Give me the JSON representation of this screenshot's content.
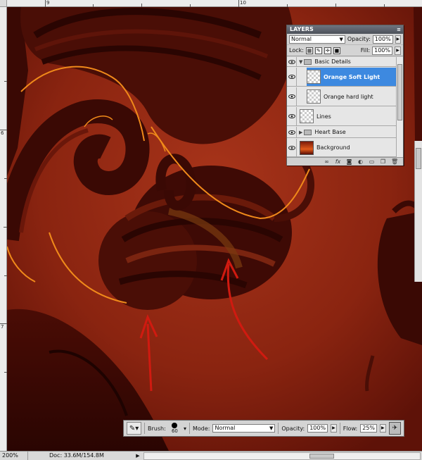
{
  "rulers": {
    "top_labels": [
      "9",
      "10"
    ],
    "left_labels": [
      "6",
      "7"
    ]
  },
  "status": {
    "zoom": "200%",
    "doc": "Doc: 33.6M/154.8M"
  },
  "layers_panel": {
    "title": "LAYERS",
    "blend_mode": "Normal",
    "opacity_label": "Opacity:",
    "opacity_value": "100%",
    "lock_label": "Lock:",
    "fill_label": "Fill:",
    "fill_value": "100%",
    "layers": [
      {
        "name": "Basic Details",
        "kind": "group-open",
        "selected": false
      },
      {
        "name": "Orange Soft Light",
        "kind": "layer-indented",
        "selected": true
      },
      {
        "name": "Orange hard light",
        "kind": "layer-indented",
        "selected": false
      },
      {
        "name": "Lines",
        "kind": "layer",
        "selected": false
      },
      {
        "name": "Heart Base",
        "kind": "group-closed",
        "selected": false
      },
      {
        "name": "Background",
        "kind": "background",
        "selected": false
      }
    ],
    "footer_icons": [
      "link-icon",
      "fx-icon",
      "mask-icon",
      "adjustment-icon",
      "group-icon",
      "new-layer-icon",
      "trash-icon"
    ]
  },
  "options_bar": {
    "brush_label": "Brush:",
    "brush_size": "60",
    "mode_label": "Mode:",
    "mode_value": "Normal",
    "opacity_label": "Opacity:",
    "opacity_value": "100%",
    "flow_label": "Flow:",
    "flow_value": "25%"
  },
  "colors": {
    "canvas_bg": "#8a2410",
    "dark_shape": "#3a0904",
    "highlight": "#f08a1a",
    "arrow": "#d01a10",
    "selected_layer": "#3d89e0"
  }
}
